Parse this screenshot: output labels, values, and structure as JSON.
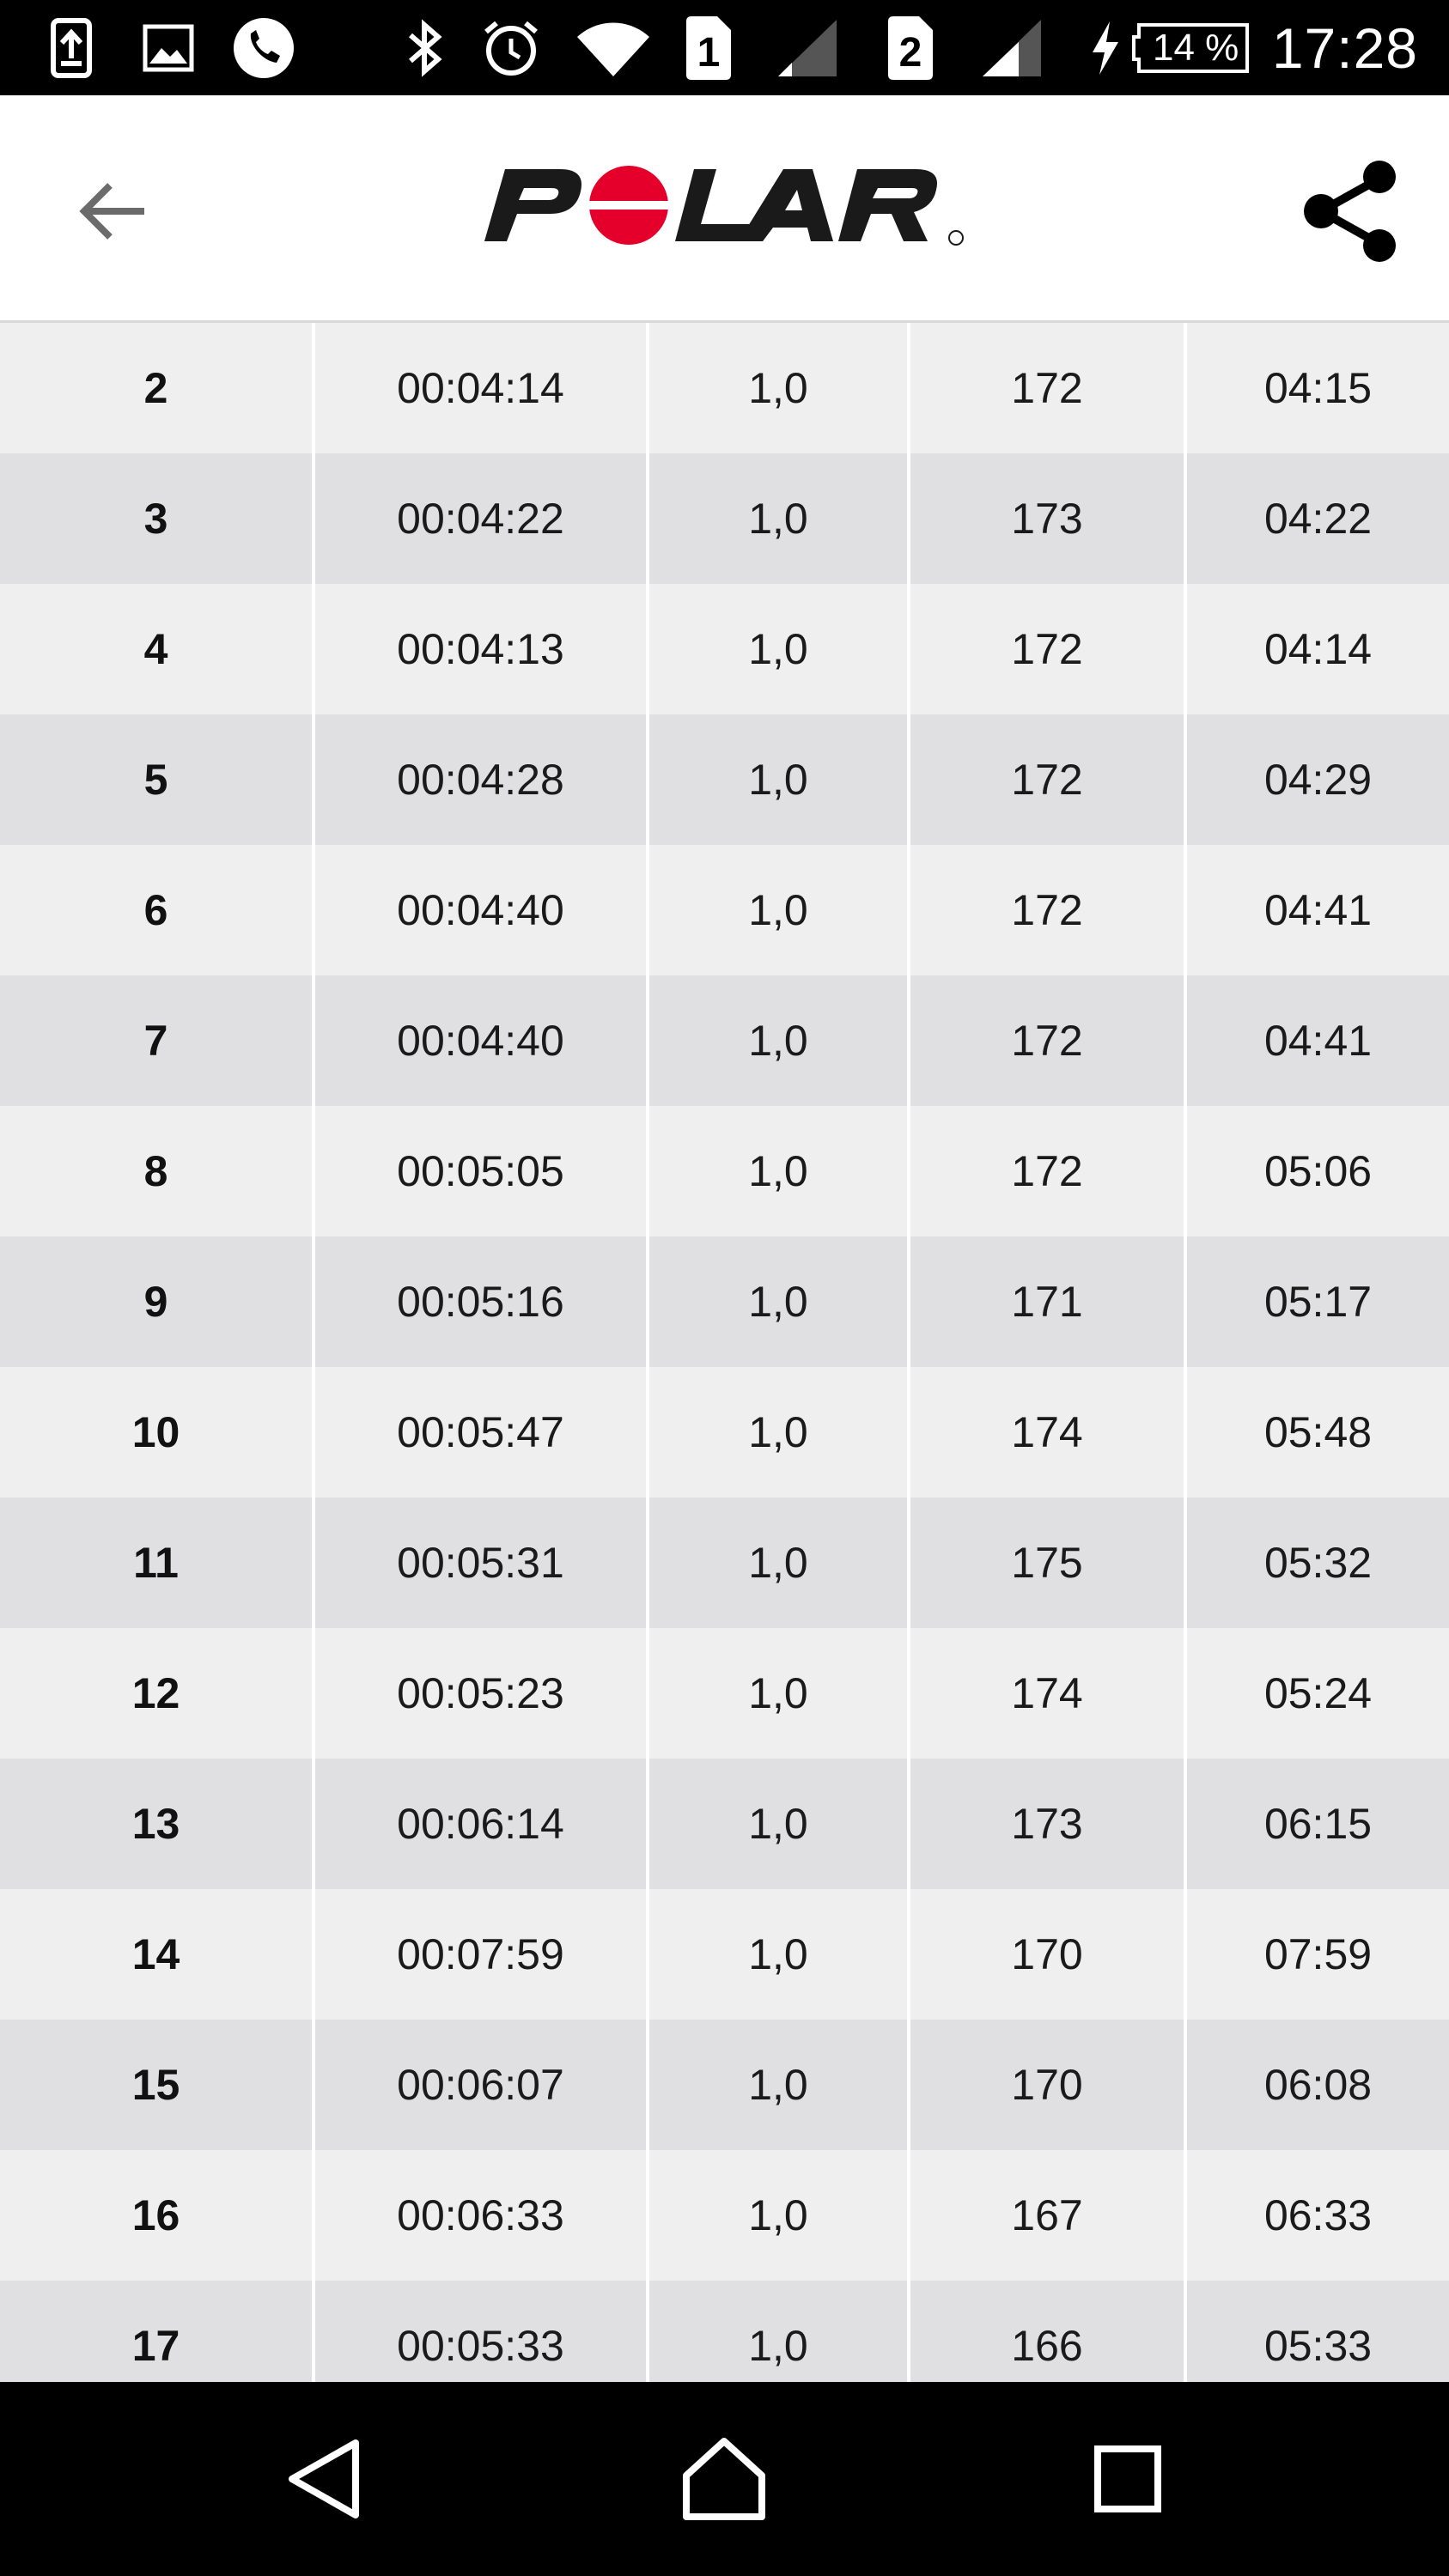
{
  "status_bar": {
    "sim1": "1",
    "sim2": "2",
    "battery": "14 %",
    "time": "17:28",
    "icons": [
      "upload-icon",
      "image-icon",
      "phone-icon",
      "bluetooth-icon",
      "alarm-icon",
      "wifi-icon",
      "sim1-icon",
      "signal-icon",
      "sim2-icon",
      "signal-icon",
      "charging-icon",
      "battery-icon"
    ]
  },
  "app_bar": {
    "logo_text": "POLAR",
    "icons": [
      "back-arrow-icon",
      "share-icon"
    ],
    "accent_color": "#e4002b"
  },
  "laps": [
    {
      "lap": "2",
      "time": "00:04:14",
      "distance": "1,0",
      "hr": "172",
      "pace": "04:15"
    },
    {
      "lap": "3",
      "time": "00:04:22",
      "distance": "1,0",
      "hr": "173",
      "pace": "04:22"
    },
    {
      "lap": "4",
      "time": "00:04:13",
      "distance": "1,0",
      "hr": "172",
      "pace": "04:14"
    },
    {
      "lap": "5",
      "time": "00:04:28",
      "distance": "1,0",
      "hr": "172",
      "pace": "04:29"
    },
    {
      "lap": "6",
      "time": "00:04:40",
      "distance": "1,0",
      "hr": "172",
      "pace": "04:41"
    },
    {
      "lap": "7",
      "time": "00:04:40",
      "distance": "1,0",
      "hr": "172",
      "pace": "04:41"
    },
    {
      "lap": "8",
      "time": "00:05:05",
      "distance": "1,0",
      "hr": "172",
      "pace": "05:06"
    },
    {
      "lap": "9",
      "time": "00:05:16",
      "distance": "1,0",
      "hr": "171",
      "pace": "05:17"
    },
    {
      "lap": "10",
      "time": "00:05:47",
      "distance": "1,0",
      "hr": "174",
      "pace": "05:48"
    },
    {
      "lap": "11",
      "time": "00:05:31",
      "distance": "1,0",
      "hr": "175",
      "pace": "05:32"
    },
    {
      "lap": "12",
      "time": "00:05:23",
      "distance": "1,0",
      "hr": "174",
      "pace": "05:24"
    },
    {
      "lap": "13",
      "time": "00:06:14",
      "distance": "1,0",
      "hr": "173",
      "pace": "06:15"
    },
    {
      "lap": "14",
      "time": "00:07:59",
      "distance": "1,0",
      "hr": "170",
      "pace": "07:59"
    },
    {
      "lap": "15",
      "time": "00:06:07",
      "distance": "1,0",
      "hr": "170",
      "pace": "06:08"
    },
    {
      "lap": "16",
      "time": "00:06:33",
      "distance": "1,0",
      "hr": "167",
      "pace": "06:33"
    },
    {
      "lap": "17",
      "time": "00:05:33",
      "distance": "1,0",
      "hr": "166",
      "pace": "05:33"
    }
  ],
  "nav_bar": {
    "icons": [
      "nav-back-icon",
      "nav-home-icon",
      "nav-recents-icon"
    ]
  }
}
